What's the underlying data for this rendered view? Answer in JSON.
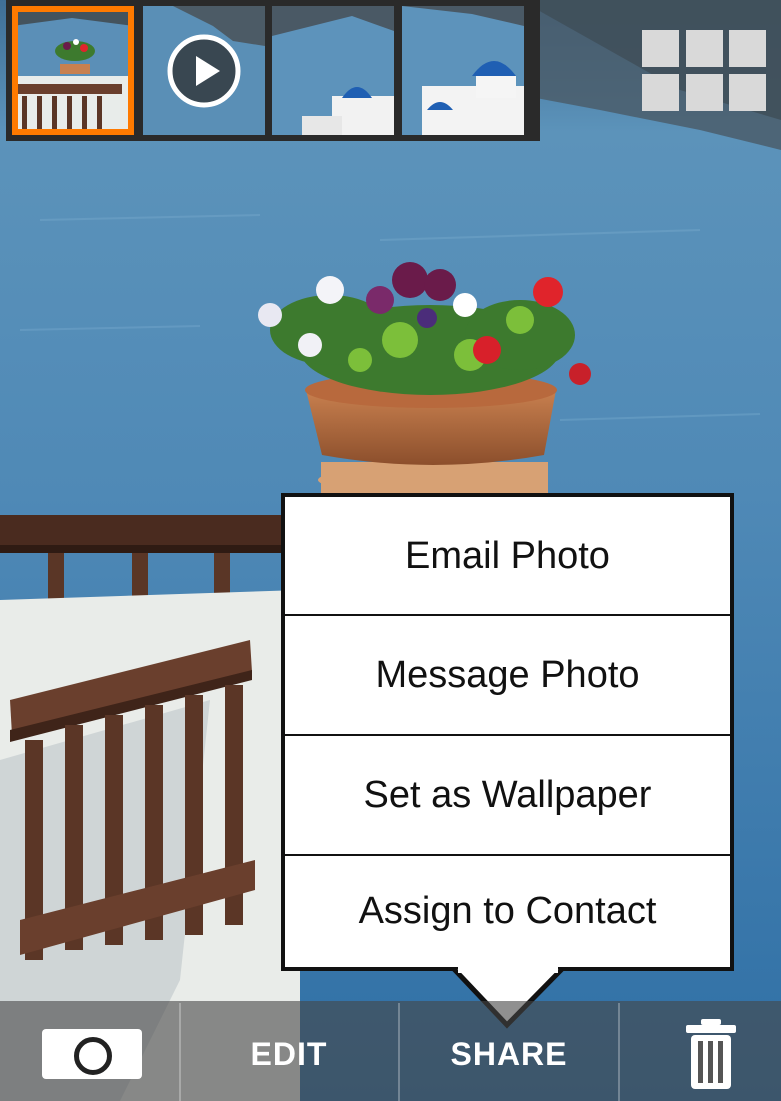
{
  "thumbnails": [
    {
      "name": "thumb-balcony-flowers",
      "selected": true
    },
    {
      "name": "thumb-video",
      "has_play_icon": true
    },
    {
      "name": "thumb-blue-dome"
    },
    {
      "name": "thumb-blue-dome-church"
    }
  ],
  "colors": {
    "selection": "#ff7a00",
    "toolbar": "#464646",
    "menu_background": "#ffffff"
  },
  "share_menu": {
    "items": [
      {
        "label": "Email Photo"
      },
      {
        "label": "Message Photo"
      },
      {
        "label": "Set as Wallpaper"
      },
      {
        "label": "Assign to Contact"
      }
    ]
  },
  "toolbar": {
    "camera_icon": "camera-icon",
    "edit_label": "EDIT",
    "share_label": "SHARE",
    "trash_icon": "trash-icon"
  },
  "icons": {
    "grid": "grid-view-icon",
    "play": "play-icon"
  }
}
